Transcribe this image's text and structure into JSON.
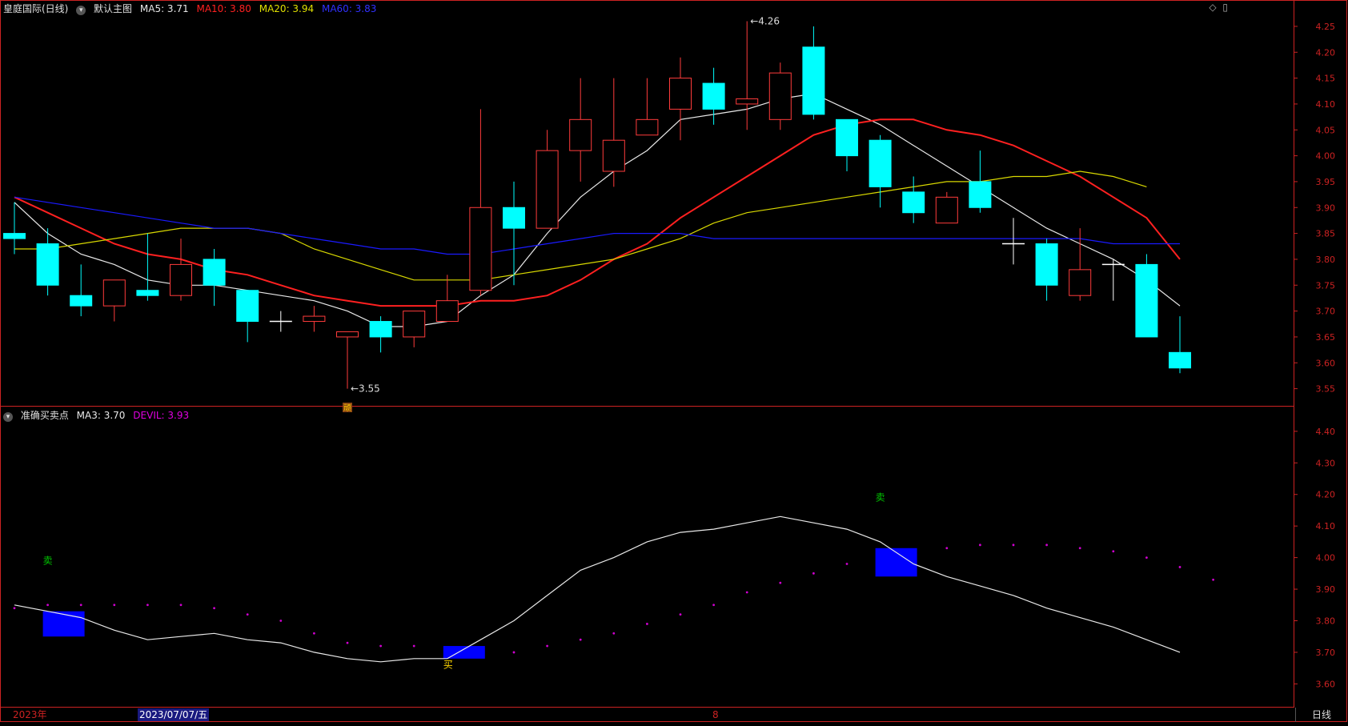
{
  "header": {
    "title": "皇庭国际(日线)",
    "chart_label": "默认主图",
    "ma5": "MA5: 3.71",
    "ma10": "MA10: 3.80",
    "ma20": "MA20: 3.94",
    "ma60": "MA60: 3.83"
  },
  "indicator_header": {
    "title": "准确买卖点",
    "ma3": "MA3: 3.70",
    "devil": "DEVIL: 3.93"
  },
  "period_label": "日线",
  "date_labels": [
    "2023年",
    "2023/07/07/五",
    "8"
  ],
  "icons": [
    "diamond-icon",
    "expand-icon"
  ],
  "colors": {
    "up": "#ff3b3b",
    "down": "#00ffff",
    "ma5": "#e8e8e8",
    "ma10": "#ff2020",
    "ma20": "#d8d800",
    "ma60": "#1a1aff",
    "devil": "#d000d0",
    "signal": "#0000ff",
    "axis": "#cc2222",
    "sell_text": "#00cc00",
    "buy_text": "#ffd700"
  },
  "chart_data": [
    {
      "type": "candlestick",
      "title": "皇庭国际(日线)",
      "ylim": [
        3.52,
        4.27
      ],
      "y_ticks": [
        "4.25",
        "4.20",
        "4.15",
        "4.10",
        "4.05",
        "4.00",
        "3.95",
        "3.90",
        "3.85",
        "3.80",
        "3.75",
        "3.70",
        "3.65",
        "3.60",
        "3.55"
      ],
      "candles": [
        {
          "o": 3.85,
          "h": 3.91,
          "l": 3.81,
          "c": 3.84
        },
        {
          "o": 3.83,
          "h": 3.86,
          "l": 3.73,
          "c": 3.75
        },
        {
          "o": 3.73,
          "h": 3.79,
          "l": 3.69,
          "c": 3.71
        },
        {
          "o": 3.71,
          "h": 3.76,
          "l": 3.68,
          "c": 3.76
        },
        {
          "o": 3.74,
          "h": 3.85,
          "l": 3.72,
          "c": 3.73
        },
        {
          "o": 3.73,
          "h": 3.84,
          "l": 3.72,
          "c": 3.79
        },
        {
          "o": 3.8,
          "h": 3.82,
          "l": 3.71,
          "c": 3.75
        },
        {
          "o": 3.74,
          "h": 3.74,
          "l": 3.64,
          "c": 3.68
        },
        {
          "o": 3.68,
          "h": 3.7,
          "l": 3.66,
          "c": 3.68
        },
        {
          "o": 3.68,
          "h": 3.71,
          "l": 3.66,
          "c": 3.69
        },
        {
          "o": 3.65,
          "h": 3.66,
          "l": 3.55,
          "c": 3.66
        },
        {
          "o": 3.68,
          "h": 3.69,
          "l": 3.62,
          "c": 3.65
        },
        {
          "o": 3.65,
          "h": 3.7,
          "l": 3.63,
          "c": 3.7
        },
        {
          "o": 3.68,
          "h": 3.77,
          "l": 3.68,
          "c": 3.72
        },
        {
          "o": 3.74,
          "h": 4.09,
          "l": 3.73,
          "c": 3.9
        },
        {
          "o": 3.9,
          "h": 3.95,
          "l": 3.75,
          "c": 3.86
        },
        {
          "o": 3.86,
          "h": 4.05,
          "l": 3.86,
          "c": 4.01
        },
        {
          "o": 4.01,
          "h": 4.15,
          "l": 3.95,
          "c": 4.07
        },
        {
          "o": 3.97,
          "h": 4.15,
          "l": 3.94,
          "c": 4.03
        },
        {
          "o": 4.04,
          "h": 4.15,
          "l": 4.04,
          "c": 4.07
        },
        {
          "o": 4.09,
          "h": 4.19,
          "l": 4.03,
          "c": 4.15
        },
        {
          "o": 4.14,
          "h": 4.17,
          "l": 4.06,
          "c": 4.09
        },
        {
          "o": 4.1,
          "h": 4.26,
          "l": 4.05,
          "c": 4.11
        },
        {
          "o": 4.07,
          "h": 4.18,
          "l": 4.05,
          "c": 4.16
        },
        {
          "o": 4.21,
          "h": 4.25,
          "l": 4.07,
          "c": 4.08
        },
        {
          "o": 4.07,
          "h": 4.07,
          "l": 3.97,
          "c": 4.0
        },
        {
          "o": 4.03,
          "h": 4.04,
          "l": 3.9,
          "c": 3.94
        },
        {
          "o": 3.93,
          "h": 3.96,
          "l": 3.87,
          "c": 3.89
        },
        {
          "o": 3.87,
          "h": 3.93,
          "l": 3.87,
          "c": 3.92
        },
        {
          "o": 3.95,
          "h": 4.01,
          "l": 3.89,
          "c": 3.9
        },
        {
          "o": 3.83,
          "h": 3.88,
          "l": 3.79,
          "c": 3.83
        },
        {
          "o": 3.83,
          "h": 3.84,
          "l": 3.72,
          "c": 3.75
        },
        {
          "o": 3.73,
          "h": 3.86,
          "l": 3.72,
          "c": 3.78
        },
        {
          "o": 3.79,
          "h": 3.8,
          "l": 3.72,
          "c": 3.79
        },
        {
          "o": 3.79,
          "h": 3.81,
          "l": 3.65,
          "c": 3.65
        },
        {
          "o": 3.62,
          "h": 3.69,
          "l": 3.58,
          "c": 3.59
        }
      ],
      "series": [
        {
          "name": "MA5",
          "color": "#e8e8e8",
          "values": [
            3.91,
            3.85,
            3.81,
            3.79,
            3.76,
            3.75,
            3.75,
            3.74,
            3.73,
            3.72,
            3.7,
            3.67,
            3.67,
            3.68,
            3.73,
            3.77,
            3.85,
            3.92,
            3.97,
            4.01,
            4.07,
            4.08,
            4.09,
            4.11,
            4.12,
            4.09,
            4.06,
            4.02,
            3.98,
            3.94,
            3.9,
            3.86,
            3.83,
            3.8,
            3.76,
            3.71
          ]
        },
        {
          "name": "MA10",
          "color": "#ff2020",
          "values": [
            3.92,
            3.89,
            3.86,
            3.83,
            3.81,
            3.8,
            3.78,
            3.77,
            3.75,
            3.73,
            3.72,
            3.71,
            3.71,
            3.71,
            3.72,
            3.72,
            3.73,
            3.76,
            3.8,
            3.83,
            3.88,
            3.92,
            3.96,
            4.0,
            4.04,
            4.06,
            4.07,
            4.07,
            4.05,
            4.04,
            4.02,
            3.99,
            3.96,
            3.92,
            3.88,
            3.8
          ]
        },
        {
          "name": "MA20",
          "color": "#d8d800",
          "values": [
            3.82,
            3.82,
            3.83,
            3.84,
            3.85,
            3.86,
            3.86,
            3.86,
            3.85,
            3.82,
            3.8,
            3.78,
            3.76,
            3.76,
            3.76,
            3.77,
            3.78,
            3.79,
            3.8,
            3.82,
            3.84,
            3.87,
            3.89,
            3.9,
            3.91,
            3.92,
            3.93,
            3.94,
            3.95,
            3.95,
            3.96,
            3.96,
            3.97,
            3.96,
            3.94
          ]
        },
        {
          "name": "MA60",
          "color": "#1a1aff",
          "values": [
            3.92,
            3.91,
            3.9,
            3.89,
            3.88,
            3.87,
            3.86,
            3.86,
            3.85,
            3.84,
            3.83,
            3.82,
            3.82,
            3.81,
            3.81,
            3.82,
            3.83,
            3.84,
            3.85,
            3.85,
            3.85,
            3.84,
            3.84,
            3.84,
            3.84,
            3.84,
            3.84,
            3.84,
            3.84,
            3.84,
            3.84,
            3.84,
            3.84,
            3.83,
            3.83,
            3.83
          ]
        }
      ],
      "annotations": [
        {
          "index": 22,
          "price": 4.26,
          "text": "4.26"
        },
        {
          "index": 10,
          "price": 3.55,
          "text": "3.55"
        },
        {
          "index": 10,
          "price": 3.52,
          "text": "顽"
        }
      ]
    },
    {
      "type": "line",
      "title": "准确买卖点",
      "ylim": [
        3.53,
        4.43
      ],
      "y_ticks": [
        "4.40",
        "4.30",
        "4.20",
        "4.10",
        "4.00",
        "3.90",
        "3.80",
        "3.70",
        "3.60"
      ],
      "series": [
        {
          "name": "MA3",
          "color": "#e8e8e8",
          "values": [
            3.85,
            3.83,
            3.81,
            3.77,
            3.74,
            3.75,
            3.76,
            3.74,
            3.73,
            3.7,
            3.68,
            3.67,
            3.68,
            3.68,
            3.74,
            3.8,
            3.88,
            3.96,
            4.0,
            4.05,
            4.08,
            4.09,
            4.11,
            4.13,
            4.11,
            4.09,
            4.05,
            3.98,
            3.94,
            3.91,
            3.88,
            3.84,
            3.81,
            3.78,
            3.74,
            3.7
          ]
        },
        {
          "name": "DEVIL",
          "color": "#d000d0",
          "values": [
            3.84,
            3.85,
            3.85,
            3.85,
            3.85,
            3.85,
            3.84,
            3.82,
            3.8,
            3.76,
            3.73,
            3.72,
            3.72,
            3.71,
            3.7,
            3.7,
            3.72,
            3.74,
            3.76,
            3.79,
            3.82,
            3.85,
            3.89,
            3.92,
            3.95,
            3.98,
            4.01,
            4.02,
            4.03,
            4.04,
            4.04,
            4.04,
            4.03,
            4.02,
            4.0,
            3.97,
            3.93
          ]
        }
      ],
      "signals": [
        {
          "index": 1,
          "type": "sell",
          "top": 3.83,
          "bottom": 3.75,
          "text": "卖",
          "text_price": 3.98
        },
        {
          "index": 13,
          "type": "buy",
          "top": 3.72,
          "bottom": 3.68,
          "text": "买",
          "text_price": 3.65
        },
        {
          "index": 26,
          "type": "sell",
          "top": 4.03,
          "bottom": 3.94,
          "text": "卖",
          "text_price": 4.18
        }
      ]
    }
  ]
}
